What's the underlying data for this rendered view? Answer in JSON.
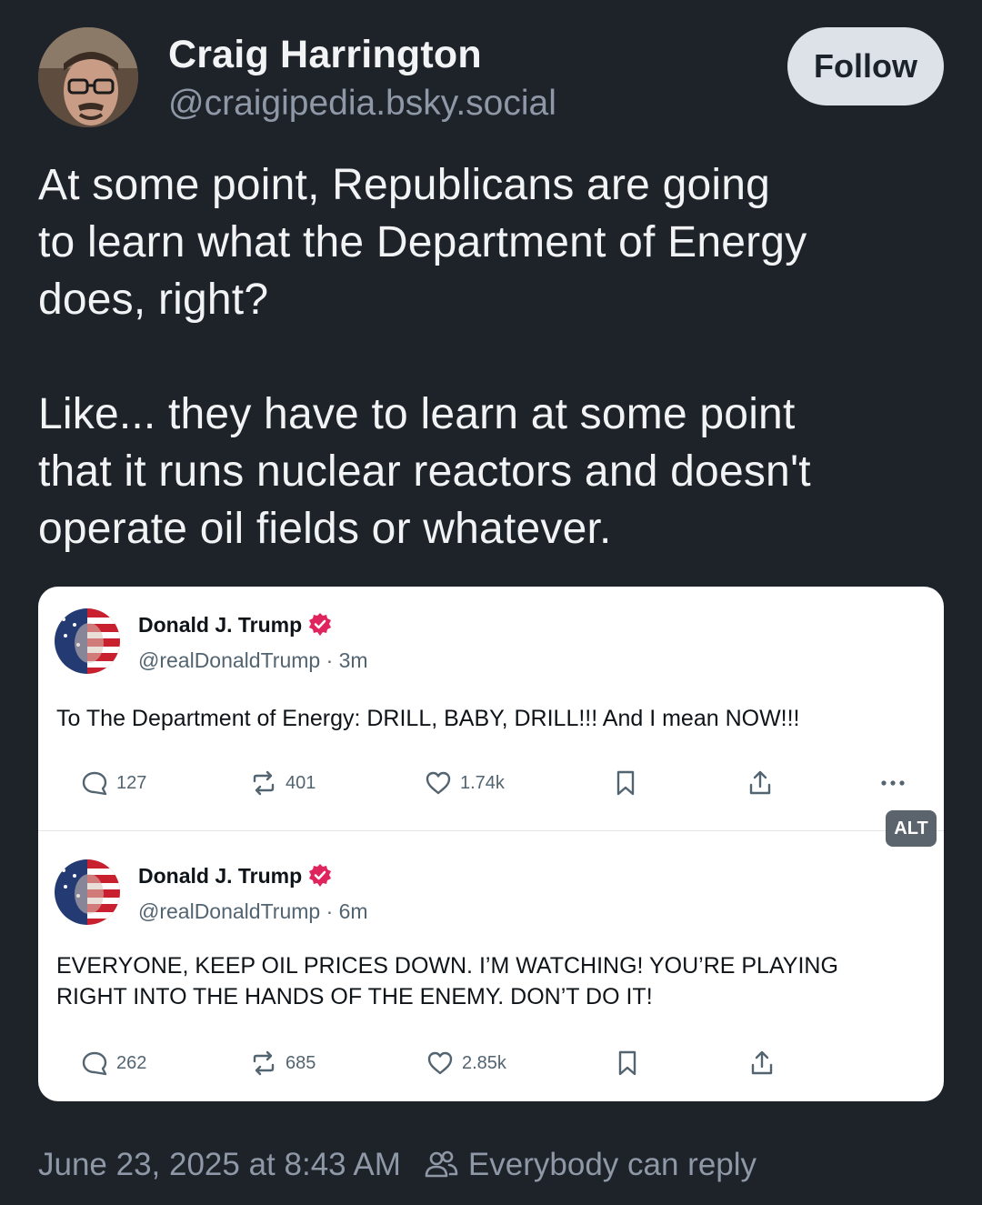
{
  "author": {
    "display_name": "Craig Harrington",
    "handle": "@craigipedia.bsky.social"
  },
  "follow_label": "Follow",
  "post": {
    "paragraph_1": [
      "At some point, Republicans are going",
      "to learn what the Department of Energy",
      "does, right?"
    ],
    "paragraph_2": [
      "Like... they have to learn at some point",
      "that it runs nuclear reactors and doesn't",
      "operate oil fields or whatever."
    ]
  },
  "embed": {
    "alt_label": "ALT",
    "posts": [
      {
        "name": "Donald J. Trump",
        "handle_time": "@realDonaldTrump · 3m",
        "lines": [
          "To The Department of Energy: DRILL, BABY, DRILL!!!  And I mean NOW!!!"
        ],
        "replies": "127",
        "reposts": "401",
        "likes": "1.74k"
      },
      {
        "name": "Donald J. Trump",
        "handle_time": "@realDonaldTrump · 6m",
        "lines": [
          "EVERYONE, KEEP OIL PRICES DOWN. I’M WATCHING! YOU’RE PLAYING",
          "RIGHT INTO THE HANDS OF THE ENEMY. DON’T DO IT!"
        ],
        "replies": "262",
        "reposts": "685",
        "likes": "2.85k"
      }
    ]
  },
  "footer": {
    "timestamp": "June 23, 2025 at 8:43 AM",
    "reply_setting": "Everybody can reply"
  },
  "colors": {
    "background": "#1e2229",
    "muted_text": "#8e98a6",
    "follow_button_bg": "#dde2e8",
    "verified_badge": "#e0245e"
  },
  "icons": [
    "reply-icon",
    "repost-icon",
    "like-icon",
    "bookmark-icon",
    "share-icon",
    "more-icon",
    "verified-icon",
    "people-icon"
  ]
}
